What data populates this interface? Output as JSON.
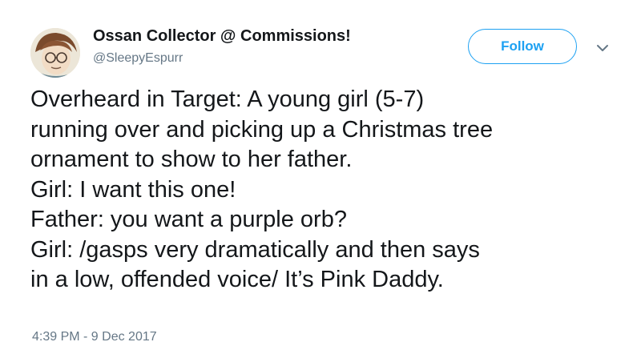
{
  "author": {
    "display_name": "Ossan Collector @ Commissions!",
    "handle": "@SleepyEspurr"
  },
  "actions": {
    "follow_label": "Follow",
    "more_icon": "chevron-down-icon"
  },
  "tweet": {
    "lines": [
      "Overheard in Target: A young girl (5-7)",
      "running over and picking up a Christmas tree",
      "ornament to show to her father.",
      "Girl: I want this one!",
      "Father: you want a purple orb?",
      "Girl: /gasps very dramatically and then says",
      "in a low, offended voice/ It’s Pink Daddy."
    ],
    "timestamp": "4:39 PM - 9 Dec 2017"
  },
  "colors": {
    "accent": "#1da1f2",
    "text": "#14171a",
    "secondary_text": "#657786"
  }
}
